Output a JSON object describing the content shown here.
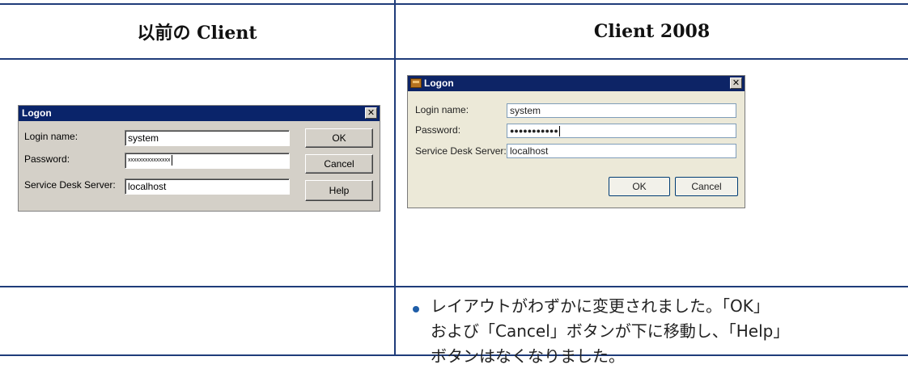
{
  "table": {
    "header_left": "以前の Client",
    "header_right": "Client 2008"
  },
  "old_dialog": {
    "title": "Logon",
    "close_glyph": "✕",
    "login_label": "Login name:",
    "login_value": "system",
    "password_label": "Password:",
    "password_value": "xxxxxxxxxxxxxxx",
    "server_label": "Service Desk Server:",
    "server_value": "localhost",
    "ok_label": "OK",
    "cancel_label": "Cancel",
    "help_label": "Help"
  },
  "new_dialog": {
    "title": "Logon",
    "close_glyph": "✕",
    "login_label": "Login name:",
    "login_value": "system",
    "password_label": "Password:",
    "password_value": "●●●●●●●●●●●",
    "server_label": "Service Desk Server:",
    "server_value": "localhost",
    "ok_label": "OK",
    "cancel_label": "Cancel"
  },
  "note": {
    "line1": "レイアウトがわずかに変更されました。「OK」",
    "line2": "および「Cancel」ボタンが下に移動し、「Help」",
    "line3": "ボタンはなくなりました。"
  }
}
